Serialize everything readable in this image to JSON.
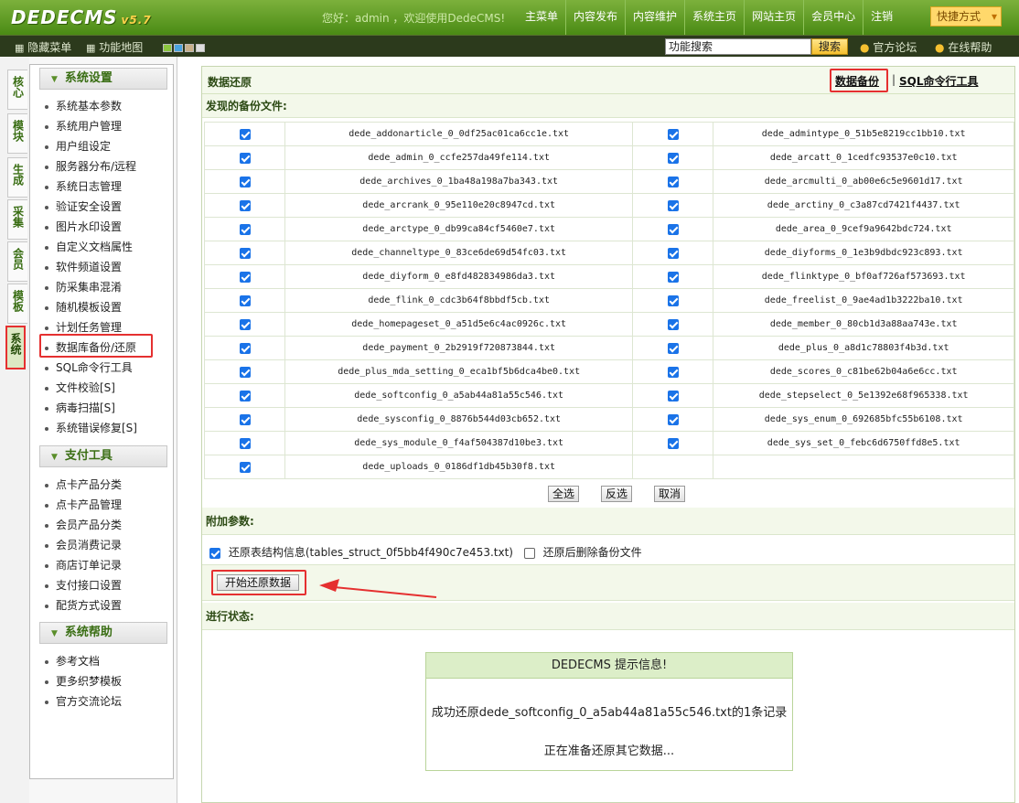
{
  "app": {
    "logo": "DEDECMS",
    "version": "v5.7",
    "welcome": "您好：admin ，欢迎使用DedeCMS!"
  },
  "topnav": [
    "主菜单",
    "内容发布",
    "内容维护",
    "系统主页",
    "网站主页",
    "会员中心",
    "注销"
  ],
  "quick_label": "快捷方式",
  "bar2": {
    "hide_menu": "隐藏菜单",
    "site_map": "功能地图",
    "search_value": "功能搜索",
    "search_btn": "搜索",
    "forum": "官方论坛",
    "help": "在线帮助"
  },
  "side_tabs": [
    "核心",
    "模块",
    "生成",
    "采集",
    "会员",
    "模板",
    "系统"
  ],
  "menu": {
    "sections": [
      {
        "title": "系统设置",
        "items": [
          "系统基本参数",
          "系统用户管理",
          "用户组设定",
          "服务器分布/远程",
          "系统日志管理",
          "验证安全设置",
          "图片水印设置",
          "自定义文档属性",
          "软件频道设置",
          "防采集串混淆",
          "随机模板设置",
          "计划任务管理",
          "数据库备份/还原",
          "SQL命令行工具",
          "文件校验[S]",
          "病毒扫描[S]",
          "系统错误修复[S]"
        ]
      },
      {
        "title": "支付工具",
        "items": [
          "点卡产品分类",
          "点卡产品管理",
          "会员产品分类",
          "会员消费记录",
          "商店订单记录",
          "支付接口设置",
          "配货方式设置"
        ]
      },
      {
        "title": "系统帮助",
        "items": [
          "参考文档",
          "更多织梦模板",
          "官方交流论坛"
        ]
      }
    ]
  },
  "main": {
    "title": "数据还原",
    "link_backup": "数据备份",
    "link_sql": "SQL命令行工具",
    "found_label": "发现的备份文件:",
    "files": [
      "dede_addonarticle_0_0df25ac01ca6cc1e.txt",
      "dede_admintype_0_51b5e8219cc1bb10.txt",
      "dede_admin_0_ccfe257da49fe114.txt",
      "dede_arcatt_0_1cedfc93537e0c10.txt",
      "dede_archives_0_1ba48a198a7ba343.txt",
      "dede_arcmulti_0_ab00e6c5e9601d17.txt",
      "dede_arcrank_0_95e110e20c8947cd.txt",
      "dede_arctiny_0_c3a87cd7421f4437.txt",
      "dede_arctype_0_db99ca84cf5460e7.txt",
      "dede_area_0_9cef9a9642bdc724.txt",
      "dede_channeltype_0_83ce6de69d54fc03.txt",
      "dede_diyforms_0_1e3b9dbdc923c893.txt",
      "dede_diyform_0_e8fd482834986da3.txt",
      "dede_flinktype_0_bf0af726af573693.txt",
      "dede_flink_0_cdc3b64f8bbdf5cb.txt",
      "dede_freelist_0_9ae4ad1b3222ba10.txt",
      "dede_homepageset_0_a51d5e6c4ac0926c.txt",
      "dede_member_0_80cb1d3a88aa743e.txt",
      "dede_payment_0_2b2919f720873844.txt",
      "dede_plus_0_a8d1c78803f4b3d.txt",
      "dede_plus_mda_setting_0_eca1bf5b6dca4be0.txt",
      "dede_scores_0_c81be62b04a6e6cc.txt",
      "dede_softconfig_0_a5ab44a81a55c546.txt",
      "dede_stepselect_0_5e1392e68f965338.txt",
      "dede_sysconfig_0_8876b544d03cb652.txt",
      "dede_sys_enum_0_692685bfc55b6108.txt",
      "dede_sys_module_0_f4af504387d10be3.txt",
      "dede_sys_set_0_febc6d6750ffd8e5.txt",
      "dede_uploads_0_0186df1db45b30f8.txt"
    ],
    "btn_all": "全选",
    "btn_invert": "反选",
    "btn_cancel": "取消",
    "extra_label": "附加参数:",
    "opt_struct": "还原表结构信息(tables_struct_0f5bb4f490c7e453.txt)",
    "opt_delete": "还原后删除备份文件",
    "start_btn": "开始还原数据",
    "status_label": "进行状态:",
    "msg_title": "DEDECMS 提示信息!",
    "msg_line1": "成功还原dede_softconfig_0_a5ab44a81a55c546.txt的1条记录",
    "msg_line2": "正在准备还原其它数据..."
  }
}
